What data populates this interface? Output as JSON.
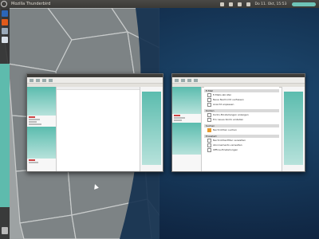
{
  "top_panel": {
    "app_title": "Mozilla Thunderbird",
    "clock": "Do 11. Okt, 15:53",
    "user": "username"
  },
  "launcher": {
    "items": [
      "thunderbird-icon",
      "firefox-icon",
      "files-icon",
      "document-icon",
      "trash-icon"
    ]
  },
  "colors": {
    "panel": "#3c3b37",
    "accent_teal": "#5ebbad",
    "wallpaper": "#13304f"
  },
  "window_right": {
    "sections": [
      {
        "header": "E-Mail",
        "rows": [
          "E-Mails abrufen",
          "Neue Nachricht verfassen",
          "Ansicht anpassen"
        ]
      },
      {
        "header": "Konten",
        "rows": [
          "Konto-Einstellungen anzeigen",
          "Ein neues Konto erstellen"
        ]
      },
      {
        "header": "Suchen",
        "rows": [
          "Nachrichten suchen"
        ]
      },
      {
        "header": "Erweitert",
        "rows": [
          "Nachrichtenfilter verwalten",
          "Abonnements verwalten",
          "Offline-Einstellungen"
        ]
      }
    ]
  }
}
